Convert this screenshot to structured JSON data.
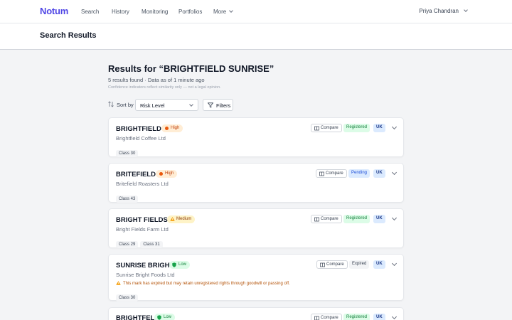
{
  "nav": {
    "logo": "Notum",
    "items": [
      "Search",
      "History",
      "Monitoring",
      "Portfolios",
      "More"
    ],
    "user": "Priya Chandran"
  },
  "header": {
    "title": "Search Results"
  },
  "results": {
    "title": "Results for “BRIGHTFIELD SUNRISE”",
    "summary": "5 results found · Data as of 1 minute ago",
    "disclaimer": "Confidence indicators reflect similarity only — not a legal opinion."
  },
  "sort": {
    "label": "Sort by",
    "selected": "Risk Level",
    "filters_label": "Filters"
  },
  "cards": [
    {
      "name": "BRIGHTFIELD",
      "risk": "High",
      "risk_level": "high",
      "owner": "Brightfield Coffee Ltd",
      "classes": [
        "Class 30"
      ],
      "compare": "Compare",
      "status": "Registered",
      "status_kind": "registered",
      "jurisdiction": "UK",
      "warning": ""
    },
    {
      "name": "BRITEFIELD",
      "risk": "High",
      "risk_level": "high",
      "owner": "Britefield Roasters Ltd",
      "classes": [
        "Class 43"
      ],
      "compare": "Compare",
      "status": "Pending",
      "status_kind": "pending",
      "jurisdiction": "UK",
      "warning": ""
    },
    {
      "name": "BRIGHT FIELDS",
      "risk": "Medium",
      "risk_level": "medium",
      "owner": "Bright Fields Farm Ltd",
      "classes": [
        "Class 29",
        "Class 31"
      ],
      "compare": "Compare",
      "status": "Registered",
      "status_kind": "registered",
      "jurisdiction": "UK",
      "warning": ""
    },
    {
      "name": "SUNRISE BRIGHT",
      "risk": "Low",
      "risk_level": "low",
      "owner": "Sunrise Bright Foods Ltd",
      "classes": [
        "Class 30"
      ],
      "compare": "Compare",
      "status": "Expired",
      "status_kind": "expired",
      "jurisdiction": "UK",
      "warning": "This mark has expired but may retain unregistered rights through goodwill or passing off."
    },
    {
      "name": "BRIGHTFELD",
      "risk": "Low",
      "risk_level": "low",
      "owner": "",
      "classes": [],
      "compare": "Compare",
      "status": "Registered",
      "status_kind": "registered",
      "jurisdiction": "UK",
      "warning": ""
    }
  ],
  "colors": {
    "brand": "#4f46e5",
    "high": "#ea580c",
    "medium": "#f59e0b",
    "low": "#16a34a"
  }
}
